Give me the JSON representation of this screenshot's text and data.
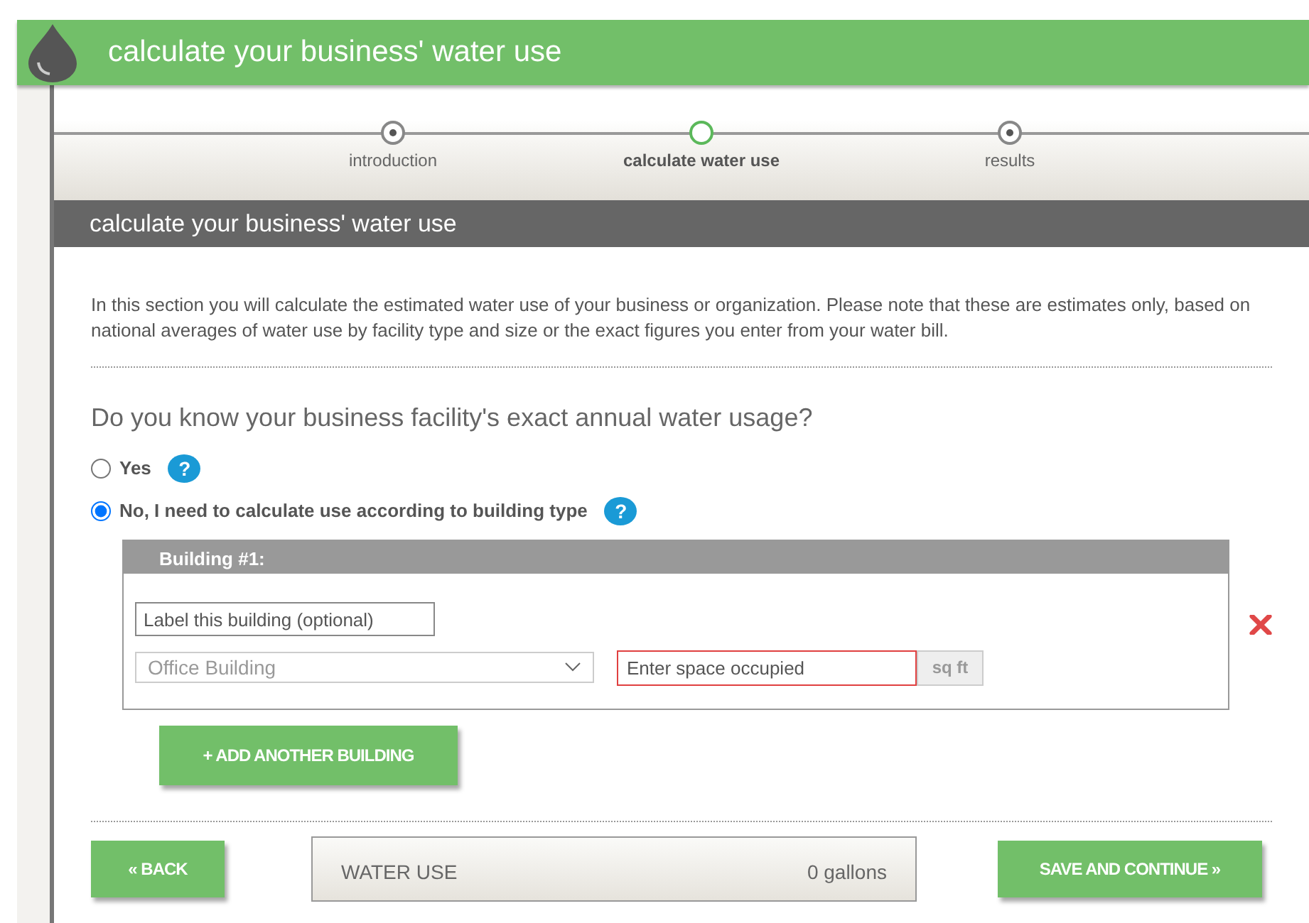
{
  "header": {
    "title": "calculate your business' water use"
  },
  "steps": [
    {
      "label": "introduction",
      "selected": false
    },
    {
      "label": "calculate water use",
      "selected": true
    },
    {
      "label": "results",
      "selected": false
    }
  ],
  "section_title": "calculate your business' water use",
  "intro": "In this section you will calculate the estimated water use of your business or organization. Please note that these are estimates only, based on national averages of water use by facility type and size or the exact figures you enter from your water bill.",
  "question": "Do you know your business facility's exact annual water usage?",
  "options": [
    {
      "label": "Yes",
      "selected": false,
      "help": "?"
    },
    {
      "label": "No, I need to calculate use according to building type",
      "selected": true,
      "help": "?"
    }
  ],
  "buildings": [
    {
      "title": "Building #1:",
      "label_field": {
        "placeholder": "Label this building (optional)"
      },
      "type_select": {
        "value": "Office Building"
      },
      "space_field": {
        "placeholder": "Enter space occupied",
        "invalid": true
      },
      "unit": "sq ft"
    }
  ],
  "add_button": "+ ADD ANOTHER BUILDING",
  "footer": {
    "back_button": "« BACK",
    "water_use_label": "WATER USE",
    "water_use_value": "0 gallons",
    "continue_button": "SAVE AND CONTINUE »"
  }
}
